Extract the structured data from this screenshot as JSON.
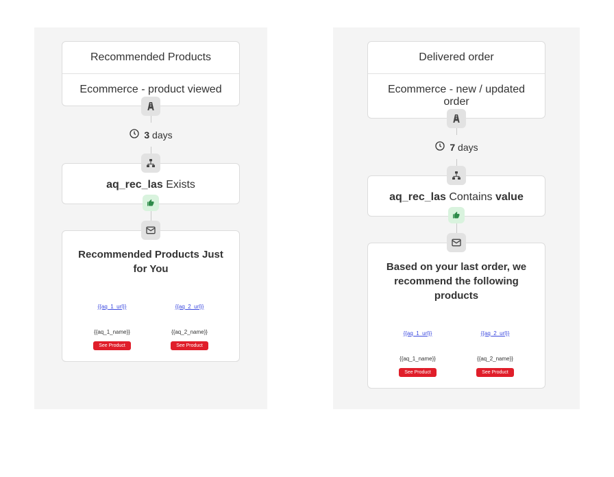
{
  "flows": [
    {
      "trigger": {
        "title": "Recommended Products",
        "event": "Ecommerce - product viewed"
      },
      "delay": {
        "value": "3",
        "unit": "days"
      },
      "condition": {
        "field": "aq_rec_las",
        "op": "Exists",
        "value": ""
      },
      "email": {
        "subject": "Recommended Products Just for You",
        "products": [
          {
            "link": "{{aq_1_url}}",
            "name": "{{aq_1_name}}",
            "btn": "See Product"
          },
          {
            "link": "{{aq_2_url}}",
            "name": "{{aq_2_name}}",
            "btn": "See Product"
          }
        ]
      }
    },
    {
      "trigger": {
        "title": "Delivered order",
        "event": "Ecommerce - new / updated order"
      },
      "delay": {
        "value": "7",
        "unit": "days"
      },
      "condition": {
        "field": "aq_rec_las",
        "op": "Contains",
        "value": "value"
      },
      "email": {
        "subject": "Based on your last order, we recommend the following products",
        "products": [
          {
            "link": "{{aq_1_url}}",
            "name": "{{aq_1_name}}",
            "btn": "See Product"
          },
          {
            "link": "{{aq_2_url}}",
            "name": "{{aq_2_name}}",
            "btn": "See Product"
          }
        ]
      }
    }
  ]
}
